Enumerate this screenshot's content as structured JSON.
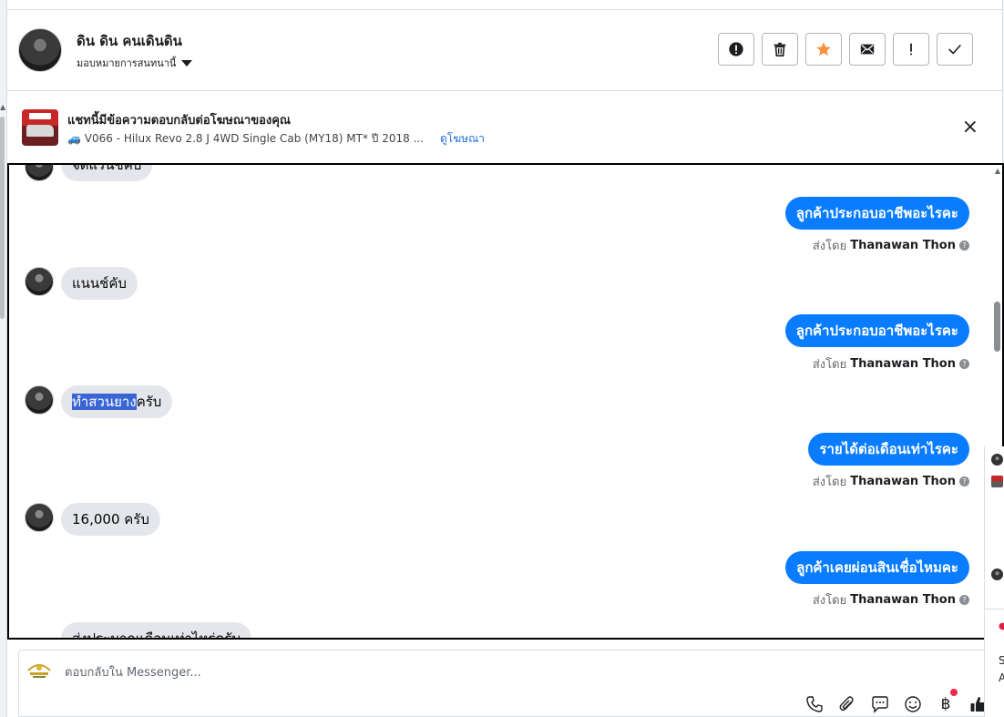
{
  "header": {
    "contact_name": "ดิน ดิน คนเดินดิน",
    "assign_label": "มอบหมายการสนทนานี้"
  },
  "actions": [
    {
      "name": "report-icon",
      "glyph": "!"
    },
    {
      "name": "trash-icon",
      "glyph": "🗑"
    },
    {
      "name": "star-icon",
      "glyph": "★"
    },
    {
      "name": "mail-icon",
      "glyph": "✉"
    },
    {
      "name": "important-icon",
      "glyph": "!"
    },
    {
      "name": "check-icon",
      "glyph": "✓"
    }
  ],
  "ad": {
    "title": "แชทนี้มีข้อความตอบกลับต่อโฆษณาของคุณ",
    "subtitle": "🚙 V066 - Hilux Revo 2.8 J 4WD Single Cab (MY18) MT* ปี 2018 ...",
    "link": "ดูโฆษณา",
    "close": "×"
  },
  "messages": {
    "m0": "จัดแรนช์คับ",
    "m1": "ลูกค้าประกอบอาชีพอะไรคะ",
    "m2": "แนนช์คับ",
    "m3": "ลูกค้าประกอบอาชีพอะไรคะ",
    "m4_selected": "ทำสวนยาง",
    "m4_rest": "ครับ",
    "m5": "รายได้ต่อเดือนเท่าไรคะ",
    "m6": "16,000 ครับ",
    "m7": "ลูกค้าเคยผ่อนสินเชื่อไหมคะ",
    "m8": "ส่งประมาณเดือนเท่าไหร่ครับ"
  },
  "sender": {
    "prefix": "ส่งโดย",
    "name": "Thanawan Thon",
    "help": "?"
  },
  "composer": {
    "placeholder": "ตอบกลับใน Messenger..."
  },
  "side": {
    "letter1": "S",
    "letter2": "A"
  },
  "colors": {
    "outgoing": "#0a7cff",
    "incoming": "#e4e6eb",
    "accent_star": "#f7923b",
    "link": "#216fdb"
  }
}
